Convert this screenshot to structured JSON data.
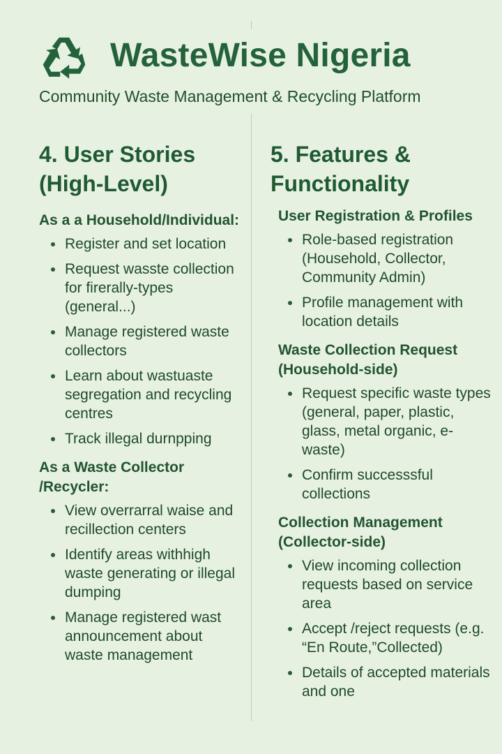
{
  "header": {
    "logo_icon": "recycle-icon",
    "title": "WasteWise Nigeria",
    "subtitle": "Community Waste Management & Recycling Platform"
  },
  "colors": {
    "background": "#e7f1e2",
    "primary": "#23623a",
    "text": "#1d4a29"
  },
  "user_stories": {
    "title": "4. User Stories (High-Level)",
    "groups": [
      {
        "heading": "As a a Household/Individual:",
        "items": [
          "Register and set location",
          "Request wasste collection for firerally-types (general...)",
          "Manage registered waste collectors",
          "Learn about wastuaste segregation and recycling centres",
          "Track illegal durnpping"
        ]
      },
      {
        "heading": "As a Waste Collector /Recycler:",
        "items": [
          "View overrarral waise and recillection centers",
          "Identify areas withhigh waste generating or illegal dumping",
          "Manage registered wast announcement about waste management"
        ]
      }
    ]
  },
  "features": {
    "title": "5. Features & Functionality",
    "groups": [
      {
        "heading": "User Registration & Profiles",
        "items": [
          "Role-based registration (Household, Collector, Community Admin)",
          "Profile management with location details"
        ]
      },
      {
        "heading": "Waste Collection Request (Household-side)",
        "items": [
          "Request specific waste types (general, paper, plastic, glass, metal organic, e-waste)",
          "Confirm successsful collections"
        ]
      },
      {
        "heading": "Collection Management (Collector-side)",
        "items": [
          "View incoming collection requests based on service area",
          "Accept /reject requests (e.g. “En Route,”Collected)",
          "Details of accepted materials and one"
        ]
      }
    ]
  }
}
